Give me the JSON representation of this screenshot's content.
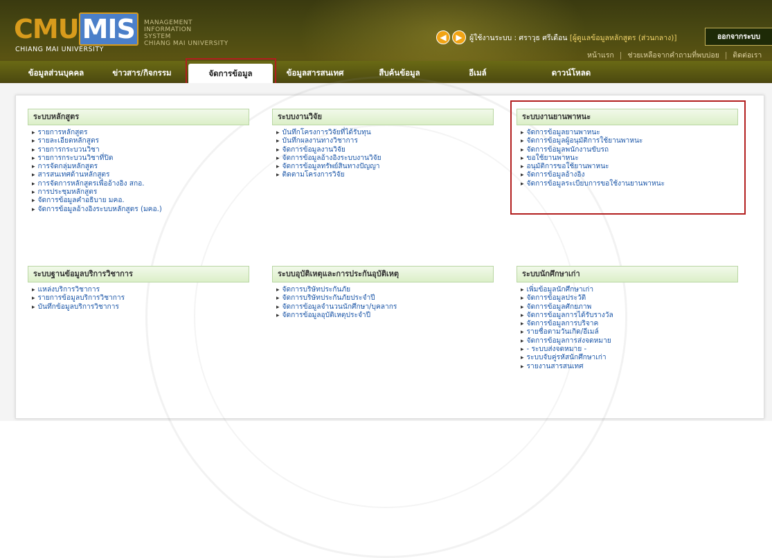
{
  "header": {
    "logo_cmu": "CMU",
    "logo_mis": "MIS",
    "logo_sub": "CHIANG MAI UNIVERSITY",
    "mis_lines": [
      "MANAGEMENT",
      "INFORMATION",
      "SYSTEM",
      "CHIANG MAI UNIVERSITY"
    ],
    "user_prefix": "ผู้ใช้งานระบบ : ศราวุธ ศรีเดือน ",
    "user_role": "[ผู้ดูแลข้อมูลหลักสูตร (ส่วนกลาง)]",
    "logout_label": "ออกจากระบบ",
    "toplinks": [
      "หน้าแรก",
      "ช่วยเหลือจากคำถามที่พบบ่อย",
      "ติดต่อเรา"
    ]
  },
  "nav": {
    "tabs": [
      "ข้อมูลส่วนบุคคล",
      "ข่าวสาร/กิจกรรม",
      "จัดการข้อมูล",
      "ข้อมูลสารสนเทศ",
      "สืบค้นข้อมูล",
      "อีเมล์",
      "ดาวน์โหลด"
    ],
    "active": "จัดการข้อมูล"
  },
  "sections": [
    {
      "title": "ระบบหลักสูตร",
      "items": [
        "รายการหลักสูตร",
        "รายละเอียดหลักสูตร",
        "รายการกระบวนวิชา",
        "รายการกระบวนวิชาที่ปิด",
        "การจัดกลุ่มหลักสูตร",
        "สารสนเทศด้านหลักสูตร",
        "การจัดการหลักสูตรเพื่ออ้างอิง สกอ.",
        "การประชุมหลักสูตร",
        "จัดการข้อมูลคำอธิบาย มคอ.",
        "จัดการข้อมูลอ้างอิงระบบหลักสูตร (มคอ.)"
      ]
    },
    {
      "title": "ระบบงานวิจัย",
      "items": [
        "บันทึกโครงการวิจัยที่ได้รับทุน",
        "บันทึกผลงานทางวิชาการ",
        "จัดการข้อมูลงานวิจัย",
        "จัดการข้อมูลอ้างอิงระบบงานวิจัย",
        "จัดการข้อมูลทรัพย์สินทางปัญญา",
        "ติดตามโครงการวิจัย"
      ]
    },
    {
      "title": "ระบบงานยานพาหนะ",
      "items": [
        "จัดการข้อมูลยานพาหนะ",
        "จัดการข้อมูลผู้อนุมัติการใช้ยานพาหนะ",
        "จัดการข้อมูลพนักงานขับรถ",
        "ขอใช้ยานพาหนะ",
        "อนุมัติการขอใช้ยานพาหนะ",
        "จัดการข้อมูลอ้างอิง",
        "จัดการข้อมูลระเบียบการขอใช้งานยานพาหนะ"
      ]
    },
    {
      "title": "ระบบฐานข้อมูลบริการวิชาการ",
      "items": [
        "แหล่งบริการวิชาการ",
        "รายการข้อมูลบริการวิชาการ",
        "บันทึกข้อมูลบริการวิชาการ"
      ]
    },
    {
      "title": "ระบบอุบัติเหตุและการประกันอุบัติเหตุ",
      "items": [
        "จัดการบริษัทประกันภัย",
        "จัดการบริษัทประกันภัยประจำปี",
        "จัดการข้อมูลจำนวนนักศึกษา/บุคลากร",
        "จัดการข้อมูลอุบัติเหตุประจำปี"
      ]
    },
    {
      "title": "ระบบนักศึกษาเก่า",
      "items": [
        "เพิ่มข้อมูลนักศึกษาเก่า",
        "จัดการข้อมูลประวัติ",
        "จัดการข้อมูลศักยภาพ",
        "จัดการข้อมูลการได้รับรางวัล",
        "จัดการข้อมูลการบริจาค",
        "รายชื่อตามวันเกิด/อีเมล์",
        "จัดการข้อมูลการส่งจดหมาย",
        "- ระบบส่งจดหมาย -",
        "ระบบจับคู่รหัสนักศึกษาเก่า",
        "รายงานสารสนเทศ"
      ]
    }
  ]
}
